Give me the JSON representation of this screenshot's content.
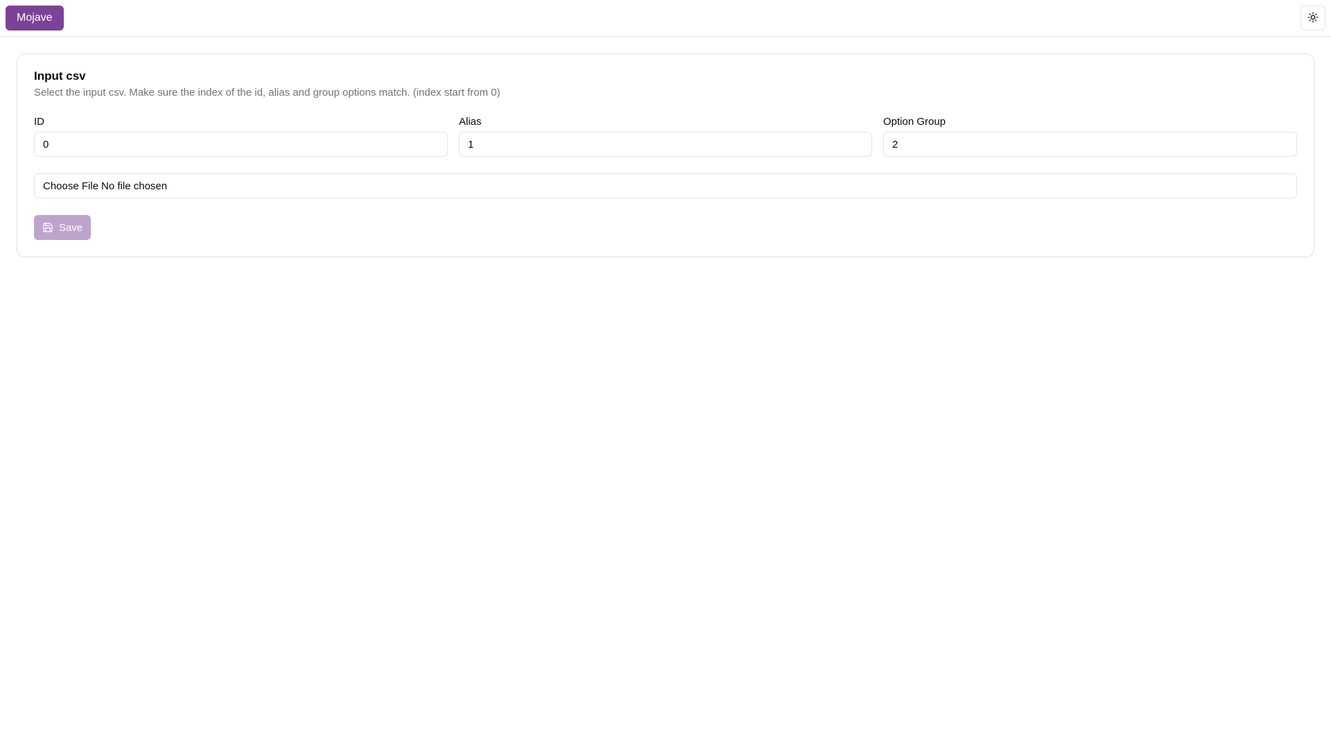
{
  "header": {
    "brand_label": "Mojave",
    "theme_toggle_icon": "sun-icon"
  },
  "card": {
    "title": "Input csv",
    "description": "Select the input csv. Make sure the index of the id, alias and group options match. (index start from 0)",
    "fields": [
      {
        "label": "ID",
        "value": "0"
      },
      {
        "label": "Alias",
        "value": "1"
      },
      {
        "label": "Option Group",
        "value": "2"
      }
    ],
    "file_input": {
      "button_label": "Choose File",
      "status": "No file chosen"
    },
    "save_button": {
      "label": "Save",
      "icon": "save-icon",
      "disabled": true
    }
  },
  "colors": {
    "accent": "#7b4397",
    "accent_disabled": "#bda4cc",
    "border": "#e4e4e7",
    "muted_text": "#71717a"
  }
}
